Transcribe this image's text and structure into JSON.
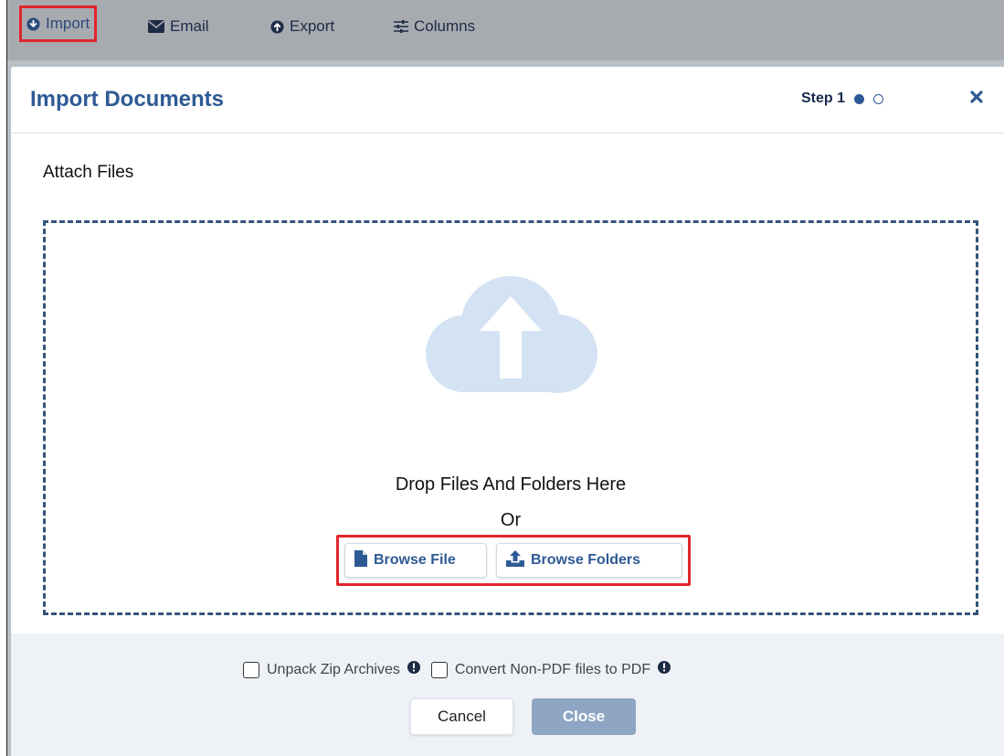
{
  "toolbar": {
    "items": [
      {
        "label": "Import",
        "icon": "import-circle-icon"
      },
      {
        "label": "Email",
        "icon": "envelope-icon"
      },
      {
        "label": "Export",
        "icon": "export-circle-icon"
      },
      {
        "label": "Columns",
        "icon": "sliders-icon"
      }
    ]
  },
  "modal": {
    "title": "Import Documents",
    "step_label": "Step 1",
    "steps_total": 2,
    "current_step": 1,
    "section_title": "Attach Files",
    "drop_text": "Drop Files And Folders Here",
    "or_text": "Or",
    "browse_file_label": "Browse File",
    "browse_folders_label": "Browse Folders",
    "options": [
      {
        "label": "Unpack Zip Archives",
        "checked": false
      },
      {
        "label": "Convert Non-PDF files to PDF",
        "checked": false
      }
    ],
    "cancel_label": "Cancel",
    "close_label": "Close"
  },
  "colors": {
    "accent": "#2e5a94",
    "highlight_border": "#e0262c",
    "cloud": "#d3e3f3",
    "close_button_bg": "#8ea5c3"
  }
}
